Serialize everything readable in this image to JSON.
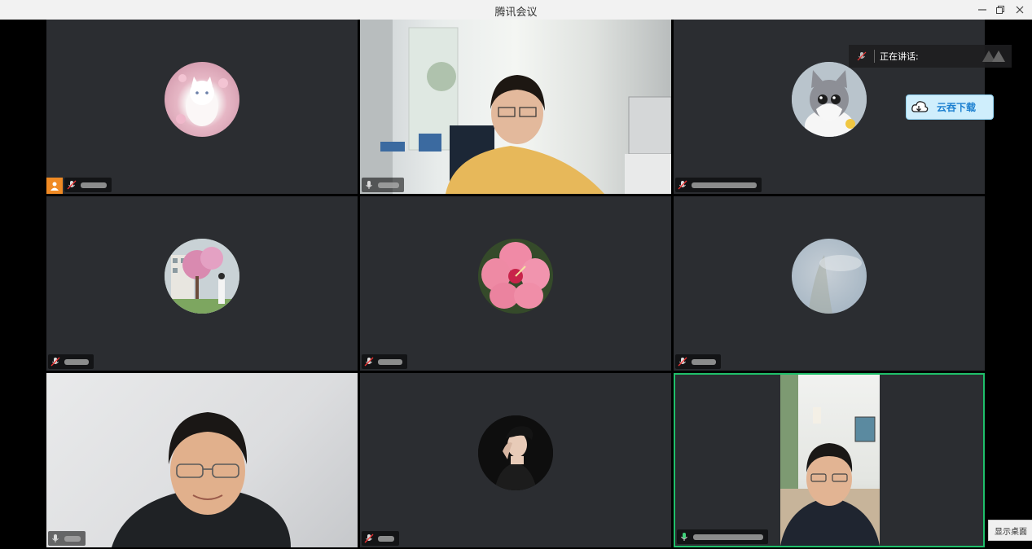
{
  "window": {
    "title": "腾讯会议"
  },
  "speaking": {
    "label": "正在讲话:"
  },
  "cloud_download": {
    "label": "云吞下载"
  },
  "show_desktop": {
    "label": "显示桌面"
  },
  "participants": [
    {
      "type": "avatar",
      "avatar": "white-cat-with-flowers",
      "host": true,
      "mic": "muted"
    },
    {
      "type": "video",
      "mic": "on"
    },
    {
      "type": "avatar",
      "avatar": "grey-white-kitten",
      "mic": "muted"
    },
    {
      "type": "avatar",
      "avatar": "cherry-blossom-campus",
      "mic": "muted"
    },
    {
      "type": "avatar",
      "avatar": "pink-hibiscus",
      "mic": "muted"
    },
    {
      "type": "avatar",
      "avatar": "cloudy-sky",
      "mic": "muted"
    },
    {
      "type": "video",
      "mic": "on"
    },
    {
      "type": "avatar",
      "avatar": "woman-portrait",
      "mic": "muted"
    },
    {
      "type": "video",
      "mic": "on",
      "active_speaker": true
    }
  ],
  "colors": {
    "active_border": "#1fbf6a",
    "host_badge": "#f08a24",
    "tile_bg": "#2b2d31"
  }
}
